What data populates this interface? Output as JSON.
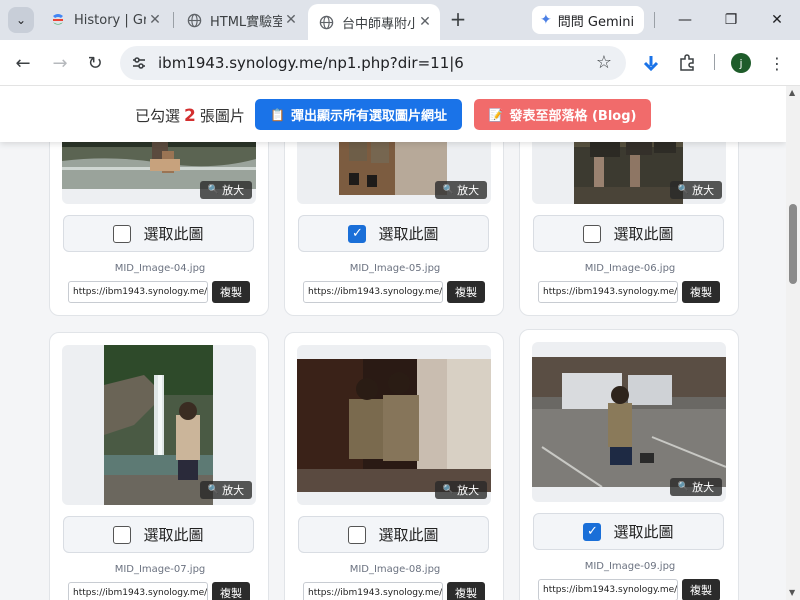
{
  "browser": {
    "tabs": [
      {
        "title": "History | Gr",
        "icon": "sheets-icon"
      },
      {
        "title": "HTML實驗室",
        "icon": "globe-icon"
      },
      {
        "title": "台中師專附小",
        "icon": "globe-icon",
        "active": true
      }
    ],
    "gemini_label": "問問 Gemini",
    "url": "ibm1943.synology.me/np1.php?dir=11|6",
    "profile_initial": "j"
  },
  "toolbar": {
    "selected_prefix": "已勾選",
    "selected_count": "2",
    "selected_suffix": "張圖片",
    "copy_all_label": "彈出顯示所有選取圖片網址",
    "blog_label": "發表至部落格 (Blog)"
  },
  "common": {
    "zoom_label": "放大",
    "select_label": "選取此圖",
    "copy_label": "複製",
    "url_value": "https://ibm1943.synology.me/"
  },
  "cards": [
    {
      "filename": "MID_Image-04.jpg",
      "checked": false
    },
    {
      "filename": "MID_Image-05.jpg",
      "checked": true
    },
    {
      "filename": "MID_Image-06.jpg",
      "checked": false
    },
    {
      "filename": "MID_Image-07.jpg",
      "checked": false
    },
    {
      "filename": "MID_Image-08.jpg",
      "checked": false
    },
    {
      "filename": "MID_Image-09.jpg",
      "checked": true
    }
  ],
  "colors": {
    "primary_button": "#1a73e8",
    "blog_button": "#f16b6b",
    "count_highlight": "#d32f2f",
    "checkbox_checked": "#1a6fd8"
  }
}
